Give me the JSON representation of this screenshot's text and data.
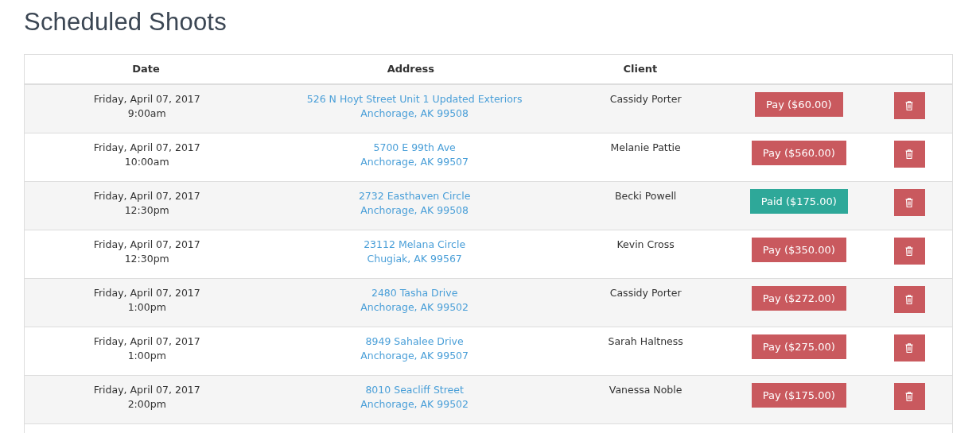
{
  "title": "Scheduled Shoots",
  "columns": [
    "Date",
    "Address",
    "Client"
  ],
  "rows": [
    {
      "date": "Friday, April 07, 2017",
      "time": "9:00am",
      "street": "526 N Hoyt Street Unit 1 Updated Exteriors",
      "city": "Anchorage, AK 99508",
      "client": "Cassidy Porter",
      "payment": "Pay ($60.00)",
      "paid": false
    },
    {
      "date": "Friday, April 07, 2017",
      "time": "10:00am",
      "street": "5700 E 99th Ave",
      "city": "Anchorage, AK 99507",
      "client": "Melanie Pattie",
      "payment": "Pay ($560.00)",
      "paid": false
    },
    {
      "date": "Friday, April 07, 2017",
      "time": "12:30pm",
      "street": "2732 Easthaven Circle",
      "city": "Anchorage, AK 99508",
      "client": "Becki Powell",
      "payment": "Paid ($175.00)",
      "paid": true
    },
    {
      "date": "Friday, April 07, 2017",
      "time": "12:30pm",
      "street": "23112 Melana Circle",
      "city": "Chugiak, AK 99567",
      "client": "Kevin Cross",
      "payment": "Pay ($350.00)",
      "paid": false
    },
    {
      "date": "Friday, April 07, 2017",
      "time": "1:00pm",
      "street": "2480 Tasha Drive",
      "city": "Anchorage, AK 99502",
      "client": "Cassidy Porter",
      "payment": "Pay ($272.00)",
      "paid": false
    },
    {
      "date": "Friday, April 07, 2017",
      "time": "1:00pm",
      "street": "8949 Sahalee Drive",
      "city": "Anchorage, AK 99507",
      "client": "Sarah Haltness",
      "payment": "Pay ($275.00)",
      "paid": false
    },
    {
      "date": "Friday, April 07, 2017",
      "time": "2:00pm",
      "street": "8010 Seacliff Street",
      "city": "Anchorage, AK 99502",
      "client": "Vanessa Noble",
      "payment": "Pay ($175.00)",
      "paid": false
    }
  ]
}
